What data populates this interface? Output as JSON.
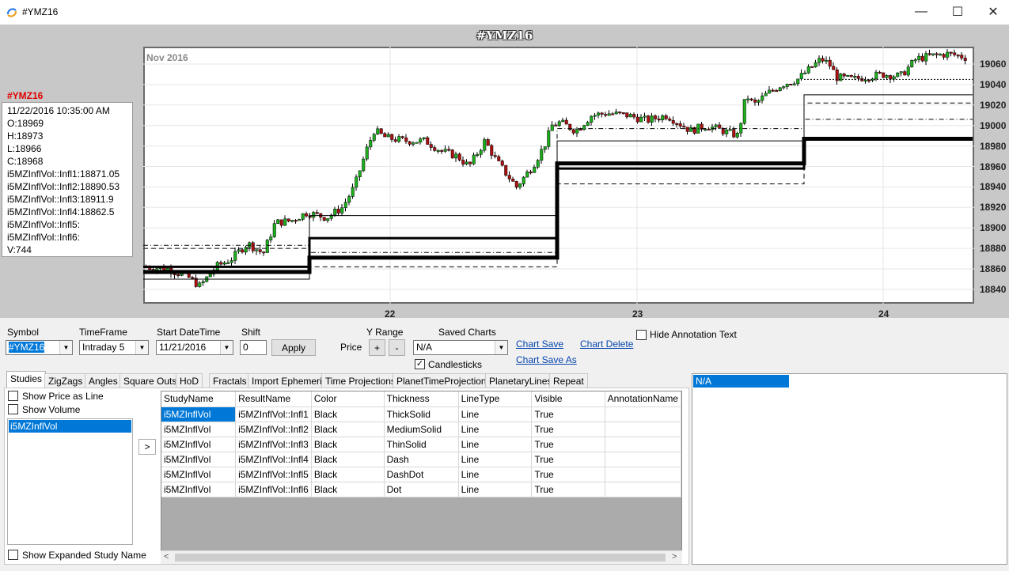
{
  "window": {
    "title": "#YMZ16",
    "minimize": "—",
    "maximize": "☐",
    "close": "✕"
  },
  "chart": {
    "title": "#YMZ16",
    "month_label": "Nov 2016",
    "y_ticks": [
      "19060",
      "19040",
      "19020",
      "19000",
      "18980",
      "18960",
      "18940",
      "18920",
      "18900",
      "18880",
      "18860",
      "18840"
    ],
    "x_ticks": [
      "22",
      "23",
      "24"
    ],
    "colors": {
      "up": "#1db01d",
      "down": "#b01010",
      "line": "#000000"
    }
  },
  "info": {
    "symbol": "#YMZ16",
    "lines": [
      "11/22/2016 10:35:00 AM",
      "O:18969",
      "H:18973",
      "L:18966",
      "C:18968",
      "i5MZInflVol::Infl1:18871.05",
      "i5MZInflVol::Infl2:18890.53",
      "i5MZInflVol::Infl3:18911.9",
      "i5MZInflVol::Infl4:18862.5",
      "i5MZInflVol::Infl5:",
      "i5MZInflVol::Infl6:",
      "V:744"
    ]
  },
  "controls": {
    "symbol_label": "Symbol",
    "symbol_value": "#YMZ16",
    "timeframe_label": "TimeFrame",
    "timeframe_value": "Intraday 5",
    "start_label": "Start DateTime",
    "start_value": "11/21/2016",
    "shift_label": "Shift",
    "shift_value": "0",
    "apply": "Apply",
    "yrange_label": "Y Range",
    "price_label": "Price",
    "plus": "+",
    "minus": "-",
    "saved_label": "Saved Charts",
    "saved_value": "N/A",
    "candlesticks": "Candlesticks",
    "candlesticks_check": "✓",
    "chart_save": "Chart Save",
    "chart_save_as": "Chart Save As",
    "chart_delete": "Chart Delete",
    "hide_annotation": "Hide Annotation Text"
  },
  "tabs": [
    "Studies",
    "ZigZags",
    "Angles",
    "Square Outs",
    "HoD",
    "Fractals",
    "Import Ephemeris",
    "Time Projections",
    "PlanetTimeProjections",
    "PlanetaryLines",
    "Repeat"
  ],
  "studies": {
    "show_price_line": "Show Price as Line",
    "show_volume": "Show Volume",
    "list": [
      "i5MZInflVol"
    ],
    "move_button": ">",
    "show_expanded": "Show Expanded Study Name",
    "columns": [
      "StudyName",
      "ResultName",
      "Color",
      "Thickness",
      "LineType",
      "Visible",
      "AnnotationName"
    ],
    "rows": [
      [
        "i5MZInflVol",
        "i5MZInflVol::Infl1",
        "Black",
        "ThickSolid",
        "Line",
        "True",
        ""
      ],
      [
        "i5MZInflVol",
        "i5MZInflVol::Infl2",
        "Black",
        "MediumSolid",
        "Line",
        "True",
        ""
      ],
      [
        "i5MZInflVol",
        "i5MZInflVol::Infl3",
        "Black",
        "ThinSolid",
        "Line",
        "True",
        ""
      ],
      [
        "i5MZInflVol",
        "i5MZInflVol::Infl4",
        "Black",
        "Dash",
        "Line",
        "True",
        ""
      ],
      [
        "i5MZInflVol",
        "i5MZInflVol::Infl5",
        "Black",
        "DashDot",
        "Line",
        "True",
        ""
      ],
      [
        "i5MZInflVol",
        "i5MZInflVol::Infl6",
        "Black",
        "Dot",
        "Line",
        "True",
        ""
      ]
    ],
    "scroll_left": "<",
    "scroll_right": ">"
  },
  "right_panel": {
    "selected": "N/A"
  }
}
